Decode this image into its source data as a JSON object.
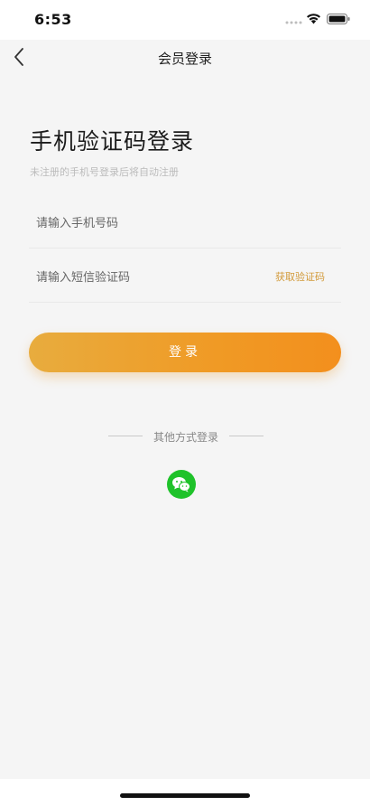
{
  "status_bar": {
    "time": "6:53"
  },
  "nav": {
    "title": "会员登录"
  },
  "login": {
    "heading": "手机验证码登录",
    "subheading": "未注册的手机号登录后将自动注册",
    "phone_placeholder": "请输入手机号码",
    "code_placeholder": "请输入短信验证码",
    "get_code_label": "获取验证码",
    "login_label": "登录"
  },
  "other_login": {
    "label": "其他方式登录",
    "icons": [
      "wechat-icon"
    ]
  },
  "colors": {
    "accent_start": "#e8ac3e",
    "accent_end": "#f38f1d",
    "get_code": "#d29a3a",
    "wechat": "#1fc22a",
    "background": "#f5f5f5"
  }
}
